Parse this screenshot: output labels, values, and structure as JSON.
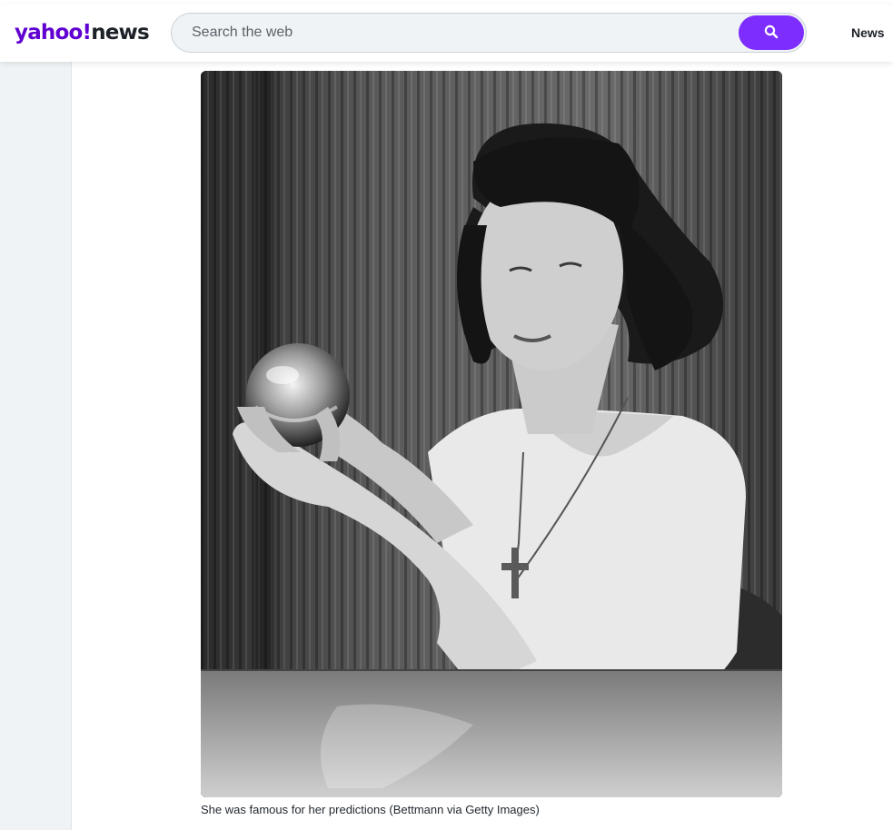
{
  "header": {
    "logo_brand": "yahoo!",
    "logo_section": "news",
    "search": {
      "placeholder": "Search the web",
      "button_icon": "search-icon"
    },
    "nav": {
      "news_label": "News"
    }
  },
  "article": {
    "image_caption": "She was famous for her predictions (Bettmann via Getty Images)"
  },
  "colors": {
    "brand_purple": "#6001d2",
    "search_button": "#7d2eff",
    "rail_background": "#f0f3f5"
  }
}
